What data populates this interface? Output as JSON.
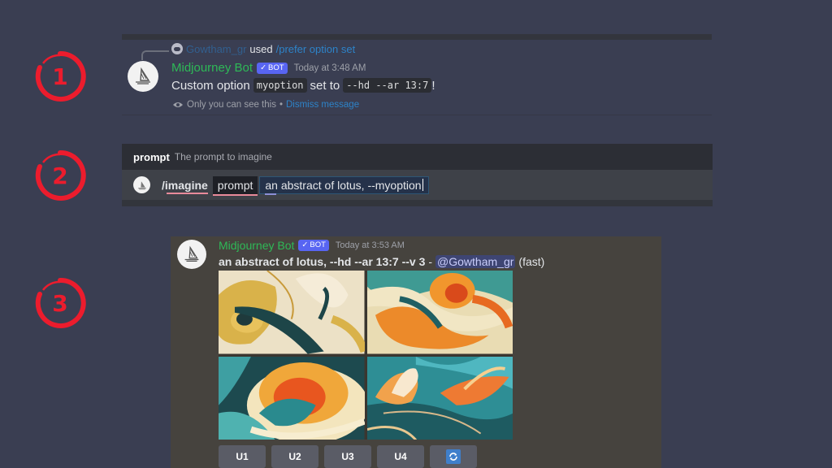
{
  "colors": {
    "background": "#3a3e52",
    "marker": "#ec1c2d",
    "author": "#2eb957",
    "bot_tag": "#5865f2",
    "link": "#2d83c8"
  },
  "markers": [
    "1",
    "2",
    "3"
  ],
  "section1": {
    "reply": {
      "user": "Gowtham_gr",
      "used": "used",
      "command": "/prefer option set"
    },
    "author": "Midjourney Bot",
    "bot_tag": "BOT",
    "timestamp": "Today at 3:48 AM",
    "body_prefix": "Custom option",
    "option_name": "myoption",
    "body_mid": "set to",
    "option_value": "--hd --ar 13:7",
    "body_suffix": "!",
    "ephemeral_note": "Only you can see this",
    "separator": "•",
    "dismiss_link": "Dismiss message"
  },
  "section2": {
    "option_label": "prompt",
    "option_description": "The prompt to imagine",
    "command": "/imagine",
    "chip_label": "prompt",
    "input_value": "an abstract of lotus, --myoption"
  },
  "section3": {
    "author": "Midjourney Bot",
    "bot_tag": "BOT",
    "timestamp": "Today at 3:53 AM",
    "prompt_text": "an abstract of lotus, --hd --ar 13:7 --v 3",
    "dash": "-",
    "mention": "@Gowtham_gr",
    "mode": "(fast)",
    "images": [
      {
        "label": "Image 1 - cream and gold lotus petals with dark teal stem"
      },
      {
        "label": "Image 2 - orange flower with teal swirl"
      },
      {
        "label": "Image 3 - cream rose swirl with orange center"
      },
      {
        "label": "Image 4 - orange lotus on teal leaves"
      }
    ],
    "buttons": [
      "U1",
      "U2",
      "U3",
      "U4"
    ],
    "reroll_icon": "refresh-icon"
  }
}
